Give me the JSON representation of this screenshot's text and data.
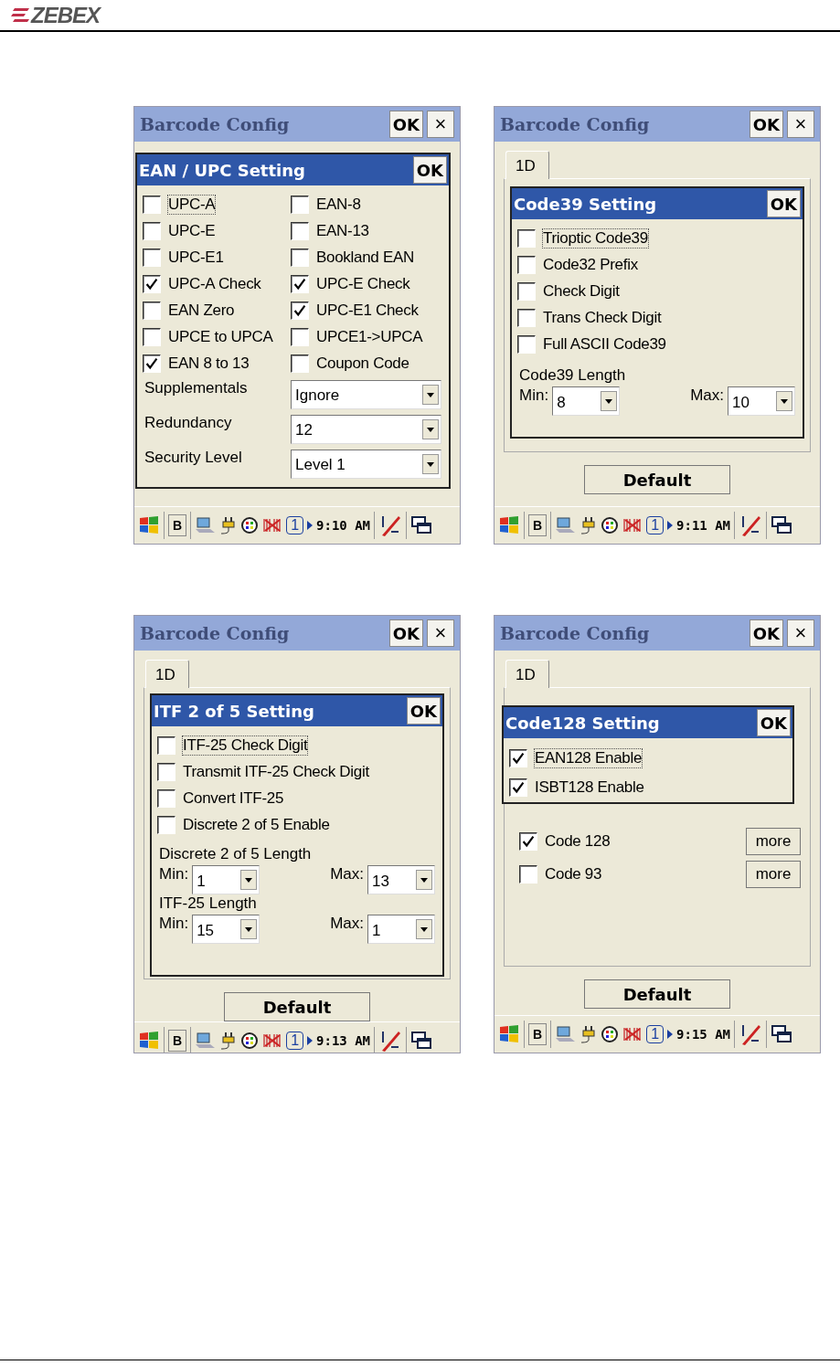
{
  "header": {
    "logo": "ZEBEX"
  },
  "screens": [
    {
      "title": "Barcode Config",
      "ok": "OK",
      "close": "×",
      "dialog": {
        "title": "EAN / UPC Setting",
        "ok": "OK",
        "columns": [
          [
            {
              "label": "UPC-A",
              "checked": false,
              "focused": true
            },
            {
              "label": "UPC-E",
              "checked": false,
              "focused": false
            },
            {
              "label": "UPC-E1",
              "checked": false,
              "focused": false
            },
            {
              "label": "UPC-A Check",
              "checked": true,
              "focused": false
            },
            {
              "label": "EAN Zero",
              "checked": false,
              "focused": false
            },
            {
              "label": "UPCE to UPCA",
              "checked": false,
              "focused": false
            },
            {
              "label": "EAN 8 to 13",
              "checked": true,
              "focused": false
            }
          ],
          [
            {
              "label": "EAN-8",
              "checked": false,
              "focused": false
            },
            {
              "label": "EAN-13",
              "checked": false,
              "focused": false
            },
            {
              "label": "Bookland EAN",
              "checked": false,
              "focused": false
            },
            {
              "label": "UPC-E Check",
              "checked": true,
              "focused": false
            },
            {
              "label": "UPC-E1 Check",
              "checked": true,
              "focused": false
            },
            {
              "label": "UPCE1->UPCA",
              "checked": false,
              "focused": false
            },
            {
              "label": "Coupon Code",
              "checked": false,
              "focused": false
            }
          ]
        ],
        "dropdowns": [
          {
            "label": "Supplementals",
            "value": "Ignore"
          },
          {
            "label": "Redundancy",
            "value": "12"
          },
          {
            "label": "Security Level",
            "value": "Level 1"
          }
        ]
      },
      "taskbar": {
        "mode": "B",
        "desktop": "1",
        "time": "9:10 AM"
      }
    },
    {
      "title": "Barcode Config",
      "ok": "OK",
      "close": "×",
      "tab": "1D",
      "dialog": {
        "title": "Code39 Setting",
        "ok": "OK",
        "columns": [
          [
            {
              "label": "Trioptic Code39",
              "checked": false,
              "focused": true
            },
            {
              "label": "Code32 Prefix",
              "checked": false,
              "focused": false
            },
            {
              "label": "Check Digit",
              "checked": false,
              "focused": false
            },
            {
              "label": "Trans Check Digit",
              "checked": false,
              "focused": false
            },
            {
              "label": "Full ASCII Code39",
              "checked": false,
              "focused": false
            }
          ]
        ],
        "lengths": [
          {
            "label": "Code39 Length",
            "min_label": "Min:",
            "min": "8",
            "max_label": "Max:",
            "max": "10"
          }
        ]
      },
      "default": "Default",
      "taskbar": {
        "mode": "B",
        "desktop": "1",
        "time": "9:11 AM"
      }
    },
    {
      "title": "Barcode Config",
      "ok": "OK",
      "close": "×",
      "tab": "1D",
      "dialog": {
        "title": "ITF 2 of 5 Setting",
        "ok": "OK",
        "columns": [
          [
            {
              "label": "ITF-25 Check Digit",
              "checked": false,
              "focused": true
            },
            {
              "label": "Transmit ITF-25 Check Digit",
              "checked": false,
              "focused": false
            },
            {
              "label": "Convert ITF-25",
              "checked": false,
              "focused": false
            },
            {
              "label": "Discrete 2 of 5 Enable",
              "checked": false,
              "focused": false
            }
          ]
        ],
        "lengths": [
          {
            "label": "Discrete 2 of 5 Length",
            "min_label": "Min:",
            "min": "1",
            "max_label": "Max:",
            "max": "13"
          },
          {
            "label": "ITF-25 Length",
            "min_label": "Min:",
            "min": "15",
            "max_label": "Max:",
            "max": "1"
          }
        ]
      },
      "default": "Default",
      "taskbar": {
        "mode": "B",
        "desktop": "1",
        "time": "9:13 AM"
      }
    },
    {
      "title": "Barcode Config",
      "ok": "OK",
      "close": "×",
      "tab": "1D",
      "list": [
        {
          "label": "Code 128",
          "checked": true,
          "more": "more"
        },
        {
          "label": "Code 93",
          "checked": false,
          "more": "more"
        }
      ],
      "dialog": {
        "title": "Code128 Setting",
        "ok": "OK",
        "columns": [
          [
            {
              "label": "EAN128 Enable",
              "checked": true,
              "focused": true
            },
            {
              "label": "ISBT128 Enable",
              "checked": true,
              "focused": false
            }
          ]
        ]
      },
      "default": "Default",
      "taskbar": {
        "mode": "B",
        "desktop": "1",
        "time": "9:15 AM"
      }
    }
  ]
}
